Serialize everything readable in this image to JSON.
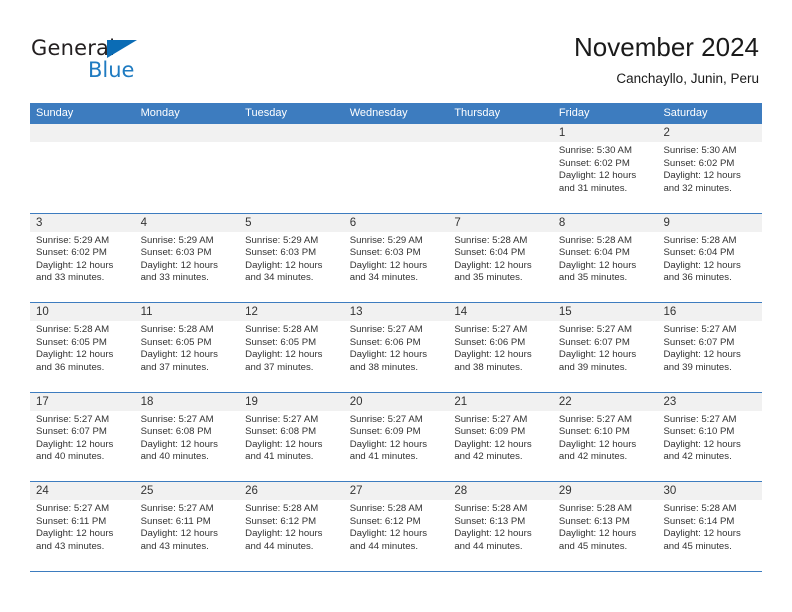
{
  "brand": {
    "name_part1": "General",
    "name_part2": "Blue",
    "accent_color": "#1f7bc1",
    "header_color": "#3d7cbf"
  },
  "header": {
    "title": "November 2024",
    "subtitle": "Canchayllo, Junin, Peru"
  },
  "weekdays": [
    "Sunday",
    "Monday",
    "Tuesday",
    "Wednesday",
    "Thursday",
    "Friday",
    "Saturday"
  ],
  "weeks": [
    [
      {
        "day": "",
        "lines": []
      },
      {
        "day": "",
        "lines": []
      },
      {
        "day": "",
        "lines": []
      },
      {
        "day": "",
        "lines": []
      },
      {
        "day": "",
        "lines": []
      },
      {
        "day": "1",
        "lines": [
          "Sunrise: 5:30 AM",
          "Sunset: 6:02 PM",
          "Daylight: 12 hours",
          "and 31 minutes."
        ]
      },
      {
        "day": "2",
        "lines": [
          "Sunrise: 5:30 AM",
          "Sunset: 6:02 PM",
          "Daylight: 12 hours",
          "and 32 minutes."
        ]
      }
    ],
    [
      {
        "day": "3",
        "lines": [
          "Sunrise: 5:29 AM",
          "Sunset: 6:02 PM",
          "Daylight: 12 hours",
          "and 33 minutes."
        ]
      },
      {
        "day": "4",
        "lines": [
          "Sunrise: 5:29 AM",
          "Sunset: 6:03 PM",
          "Daylight: 12 hours",
          "and 33 minutes."
        ]
      },
      {
        "day": "5",
        "lines": [
          "Sunrise: 5:29 AM",
          "Sunset: 6:03 PM",
          "Daylight: 12 hours",
          "and 34 minutes."
        ]
      },
      {
        "day": "6",
        "lines": [
          "Sunrise: 5:29 AM",
          "Sunset: 6:03 PM",
          "Daylight: 12 hours",
          "and 34 minutes."
        ]
      },
      {
        "day": "7",
        "lines": [
          "Sunrise: 5:28 AM",
          "Sunset: 6:04 PM",
          "Daylight: 12 hours",
          "and 35 minutes."
        ]
      },
      {
        "day": "8",
        "lines": [
          "Sunrise: 5:28 AM",
          "Sunset: 6:04 PM",
          "Daylight: 12 hours",
          "and 35 minutes."
        ]
      },
      {
        "day": "9",
        "lines": [
          "Sunrise: 5:28 AM",
          "Sunset: 6:04 PM",
          "Daylight: 12 hours",
          "and 36 minutes."
        ]
      }
    ],
    [
      {
        "day": "10",
        "lines": [
          "Sunrise: 5:28 AM",
          "Sunset: 6:05 PM",
          "Daylight: 12 hours",
          "and 36 minutes."
        ]
      },
      {
        "day": "11",
        "lines": [
          "Sunrise: 5:28 AM",
          "Sunset: 6:05 PM",
          "Daylight: 12 hours",
          "and 37 minutes."
        ]
      },
      {
        "day": "12",
        "lines": [
          "Sunrise: 5:28 AM",
          "Sunset: 6:05 PM",
          "Daylight: 12 hours",
          "and 37 minutes."
        ]
      },
      {
        "day": "13",
        "lines": [
          "Sunrise: 5:27 AM",
          "Sunset: 6:06 PM",
          "Daylight: 12 hours",
          "and 38 minutes."
        ]
      },
      {
        "day": "14",
        "lines": [
          "Sunrise: 5:27 AM",
          "Sunset: 6:06 PM",
          "Daylight: 12 hours",
          "and 38 minutes."
        ]
      },
      {
        "day": "15",
        "lines": [
          "Sunrise: 5:27 AM",
          "Sunset: 6:07 PM",
          "Daylight: 12 hours",
          "and 39 minutes."
        ]
      },
      {
        "day": "16",
        "lines": [
          "Sunrise: 5:27 AM",
          "Sunset: 6:07 PM",
          "Daylight: 12 hours",
          "and 39 minutes."
        ]
      }
    ],
    [
      {
        "day": "17",
        "lines": [
          "Sunrise: 5:27 AM",
          "Sunset: 6:07 PM",
          "Daylight: 12 hours",
          "and 40 minutes."
        ]
      },
      {
        "day": "18",
        "lines": [
          "Sunrise: 5:27 AM",
          "Sunset: 6:08 PM",
          "Daylight: 12 hours",
          "and 40 minutes."
        ]
      },
      {
        "day": "19",
        "lines": [
          "Sunrise: 5:27 AM",
          "Sunset: 6:08 PM",
          "Daylight: 12 hours",
          "and 41 minutes."
        ]
      },
      {
        "day": "20",
        "lines": [
          "Sunrise: 5:27 AM",
          "Sunset: 6:09 PM",
          "Daylight: 12 hours",
          "and 41 minutes."
        ]
      },
      {
        "day": "21",
        "lines": [
          "Sunrise: 5:27 AM",
          "Sunset: 6:09 PM",
          "Daylight: 12 hours",
          "and 42 minutes."
        ]
      },
      {
        "day": "22",
        "lines": [
          "Sunrise: 5:27 AM",
          "Sunset: 6:10 PM",
          "Daylight: 12 hours",
          "and 42 minutes."
        ]
      },
      {
        "day": "23",
        "lines": [
          "Sunrise: 5:27 AM",
          "Sunset: 6:10 PM",
          "Daylight: 12 hours",
          "and 42 minutes."
        ]
      }
    ],
    [
      {
        "day": "24",
        "lines": [
          "Sunrise: 5:27 AM",
          "Sunset: 6:11 PM",
          "Daylight: 12 hours",
          "and 43 minutes."
        ]
      },
      {
        "day": "25",
        "lines": [
          "Sunrise: 5:27 AM",
          "Sunset: 6:11 PM",
          "Daylight: 12 hours",
          "and 43 minutes."
        ]
      },
      {
        "day": "26",
        "lines": [
          "Sunrise: 5:28 AM",
          "Sunset: 6:12 PM",
          "Daylight: 12 hours",
          "and 44 minutes."
        ]
      },
      {
        "day": "27",
        "lines": [
          "Sunrise: 5:28 AM",
          "Sunset: 6:12 PM",
          "Daylight: 12 hours",
          "and 44 minutes."
        ]
      },
      {
        "day": "28",
        "lines": [
          "Sunrise: 5:28 AM",
          "Sunset: 6:13 PM",
          "Daylight: 12 hours",
          "and 44 minutes."
        ]
      },
      {
        "day": "29",
        "lines": [
          "Sunrise: 5:28 AM",
          "Sunset: 6:13 PM",
          "Daylight: 12 hours",
          "and 45 minutes."
        ]
      },
      {
        "day": "30",
        "lines": [
          "Sunrise: 5:28 AM",
          "Sunset: 6:14 PM",
          "Daylight: 12 hours",
          "and 45 minutes."
        ]
      }
    ]
  ]
}
